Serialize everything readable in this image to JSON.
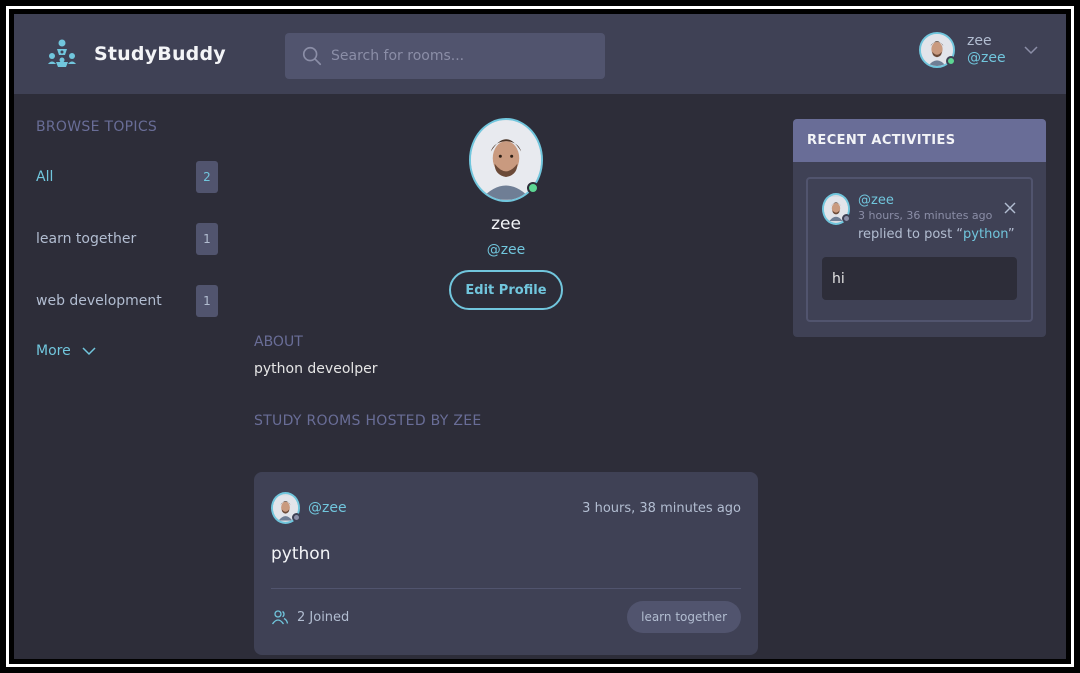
{
  "brand": {
    "name": "StudyBuddy",
    "icon": "studybuddy-logo-icon"
  },
  "search": {
    "placeholder": "Search for rooms..."
  },
  "user": {
    "name": "zee",
    "handle": "@zee",
    "status": "online"
  },
  "topics": {
    "title": "BROWSE TOPICS",
    "items": [
      {
        "label": "All",
        "count": "2",
        "active": true
      },
      {
        "label": "learn together",
        "count": "1",
        "active": false
      },
      {
        "label": "web development",
        "count": "1",
        "active": false
      }
    ],
    "more_label": "More"
  },
  "profile": {
    "name": "zee",
    "handle": "@zee",
    "edit_label": "Edit Profile",
    "about_title": "ABOUT",
    "about_text": "python deveolper",
    "rooms_title": "STUDY ROOMS HOSTED BY ZEE"
  },
  "room": {
    "host": "@zee",
    "time": "3 hours, 38 minutes ago",
    "title": "python",
    "joined": "2 Joined",
    "topic": "learn together"
  },
  "activities": {
    "title": "RECENT ACTIVITIES",
    "item": {
      "handle": "@zee",
      "time": "3 hours, 36 minutes ago",
      "action": "replied to post “",
      "post": "python",
      "action_end": "”",
      "reply": "hi"
    }
  },
  "colors": {
    "background": "#2d2d39",
    "surface": "#3f4155",
    "accent": "#71c6dd",
    "muted_heading": "#696d97",
    "online": "#5dd693",
    "offline": "#8b8ea7"
  }
}
